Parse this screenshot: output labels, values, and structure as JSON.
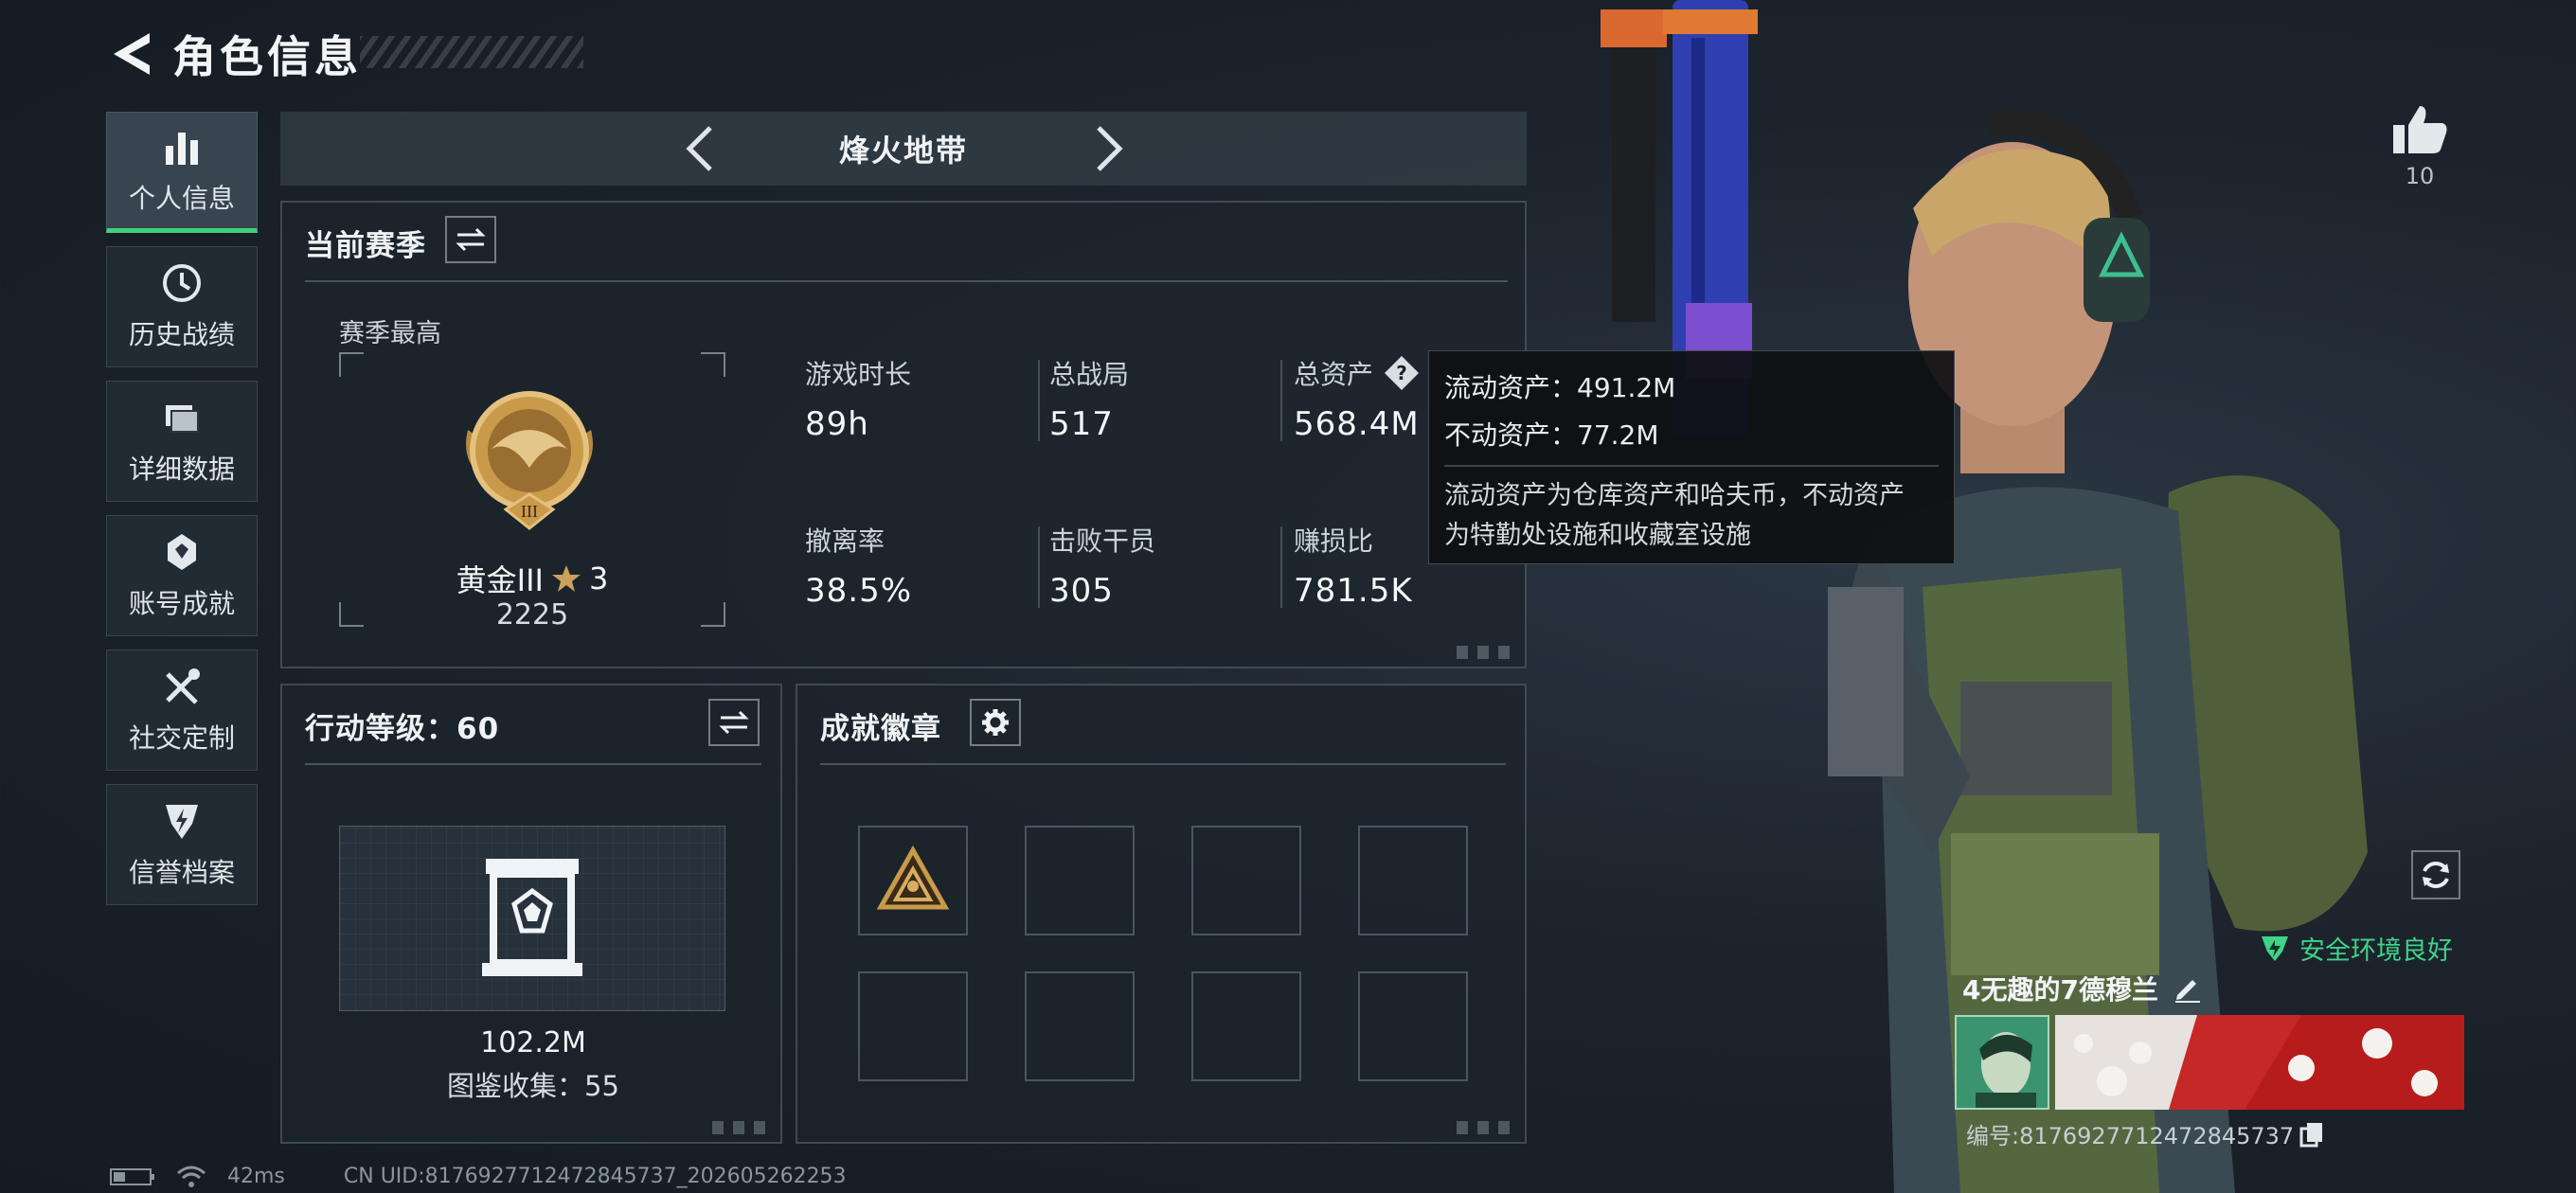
{
  "header": {
    "title": "角色信息"
  },
  "sidebar": {
    "items": [
      {
        "label": "个人信息",
        "icon": "bar-chart-icon",
        "active": true
      },
      {
        "label": "历史战绩",
        "icon": "history-icon",
        "active": false
      },
      {
        "label": "详细数据",
        "icon": "folder-icon",
        "active": false
      },
      {
        "label": "账号成就",
        "icon": "achievement-icon",
        "active": false
      },
      {
        "label": "社交定制",
        "icon": "tools-icon",
        "active": false
      },
      {
        "label": "信誉档案",
        "icon": "credit-icon",
        "active": false
      }
    ]
  },
  "mode": {
    "title": "烽火地带"
  },
  "season": {
    "title": "当前赛季",
    "best_label": "赛季最高",
    "rank_name": "黄金III",
    "rank_stars": "3",
    "rank_score": "2225",
    "stats": [
      {
        "label": "游戏时长",
        "value": "89h"
      },
      {
        "label": "总战局",
        "value": "517"
      },
      {
        "label": "总资产",
        "value": "568.4M"
      },
      {
        "label": "撤离率",
        "value": "38.5%"
      },
      {
        "label": "击败干员",
        "value": "305"
      },
      {
        "label": "赚损比",
        "value": "781.5K"
      }
    ]
  },
  "tooltip": {
    "liquid": "流动资产：491.2M",
    "fixed": "不动资产：77.2M",
    "desc_line1": "流动资产为仓库资产和哈夫币，不动资产",
    "desc_line2": "为特勤处设施和收藏室设施"
  },
  "level": {
    "title": "行动等级：60",
    "collection_value": "102.2M",
    "collection_label": "图鉴收集：55"
  },
  "badges": {
    "title": "成就徽章"
  },
  "like": {
    "count": "10"
  },
  "safe": {
    "text": "安全环境良好"
  },
  "player": {
    "name": "4无趣的7德穆兰",
    "id": "编号:8176927712472845737"
  },
  "statusbar": {
    "ping": "42ms",
    "uid": "CN UID:8176927712472845737_202605262253"
  },
  "colors": {
    "accent_green": "#3fd07c",
    "safe_green": "#3fd489",
    "rank_gold": "#c99a4a"
  }
}
